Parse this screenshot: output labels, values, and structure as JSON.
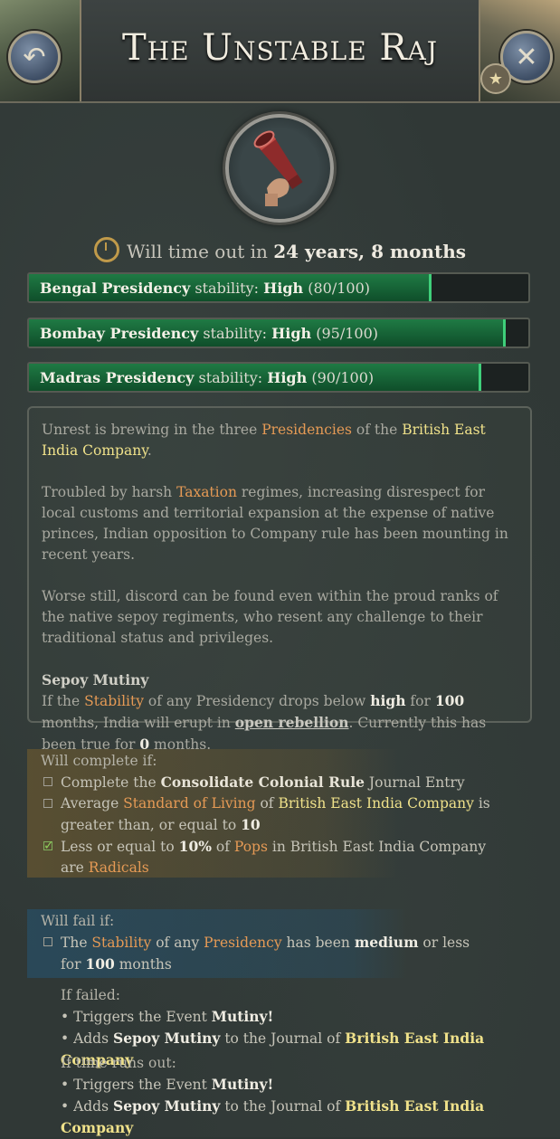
{
  "header": {
    "title": "The Unstable Raj",
    "back_icon": "↶",
    "close_icon": "✕",
    "star_icon": "★"
  },
  "timeout": {
    "prefix": "Will time out in",
    "value": "24 years, 8 months"
  },
  "bars": [
    {
      "name": "Bengal Presidency",
      "label": "stability:",
      "level": "High",
      "value": "(80/100)",
      "fraction": 0.8
    },
    {
      "name": "Bombay Presidency",
      "label": "stability:",
      "level": "High",
      "value": "(95/100)",
      "fraction": 0.95
    },
    {
      "name": "Madras Presidency",
      "label": "stability:",
      "level": "High",
      "value": "(90/100)",
      "fraction": 0.9
    }
  ],
  "description": {
    "p1": {
      "a": "Unrest is brewing in the three ",
      "b": "Presidencies",
      "c": " of the ",
      "d": "British East India Company",
      "e": "."
    },
    "p2": {
      "a": "Troubled by harsh ",
      "b": "Taxation",
      "c": " regimes, increasing disrespect for local customs and territorial expansion at the expense of native princes, Indian opposition to Company rule has been mounting in recent years."
    },
    "p3": "Worse still, discord can be found even within the proud ranks of the native sepoy regiments, who resent any challenge to their traditional status and privileges.",
    "p4": {
      "heading": "Sepoy Mutiny",
      "a": "If the ",
      "b": "Stability",
      "c": " of any Presidency drops below ",
      "d": "high",
      "e": " for ",
      "f": "100",
      "g": " months, India will erupt in ",
      "h": "open rebellion",
      "i": ". Currently this has been true for ",
      "j": "0",
      "k": " months."
    }
  },
  "complete": {
    "heading": "Will complete if:",
    "c1": {
      "a": "Complete the ",
      "b": "Consolidate Colonial Rule",
      "c": " Journal Entry",
      "checked": false
    },
    "c2": {
      "a": "Average ",
      "b": "Standard of Living",
      "c": " of ",
      "d": "British East India Company",
      "e": " is greater than, or equal to ",
      "f": "10",
      "checked": false
    },
    "c3": {
      "a": "Less or equal to ",
      "b": "10%",
      "c": " of ",
      "d": "Pops",
      "e": " in British East India Company are ",
      "f": "Radicals",
      "checked": true
    }
  },
  "fail": {
    "heading": "Will fail if:",
    "c1": {
      "a": "The ",
      "b": "Stability",
      "c": " of any ",
      "d": "Presidency",
      "e": " has been ",
      "f": "medium",
      "g": " or less for ",
      "h": "100",
      "i": " months",
      "checked": false
    }
  },
  "if_failed": {
    "heading": "If failed:",
    "b1": {
      "a": "• Triggers the Event ",
      "b": "Mutiny!"
    },
    "b2": {
      "a": "• Adds ",
      "b": "Sepoy Mutiny",
      "c": " to the Journal of ",
      "d": "British East India Company"
    }
  },
  "if_timeout": {
    "heading": "If time runs out:",
    "b1": {
      "a": "• Triggers the Event ",
      "b": "Mutiny!"
    },
    "b2": {
      "a": "• Adds ",
      "b": "Sepoy Mutiny",
      "c": " to the Journal of ",
      "d": "British East India Company"
    }
  }
}
